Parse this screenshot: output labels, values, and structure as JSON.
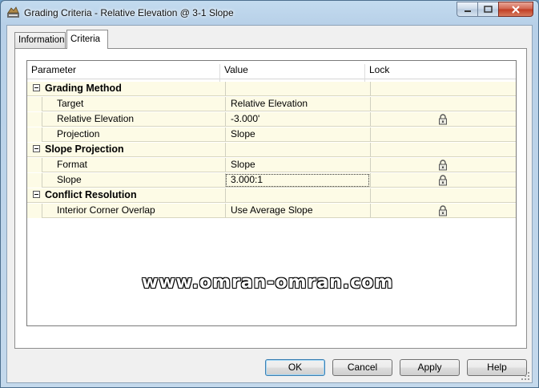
{
  "window": {
    "title": "Grading Criteria - Relative Elevation @ 3-1 Slope"
  },
  "tabs": [
    {
      "label": "Information",
      "active": false
    },
    {
      "label": "Criteria",
      "active": true
    }
  ],
  "grid": {
    "columns": [
      "Parameter",
      "Value",
      "Lock"
    ],
    "groups": [
      {
        "name": "Grading Method",
        "expanded": true,
        "rows": [
          {
            "parameter": "Target",
            "value": "Relative Elevation",
            "locked": false
          },
          {
            "parameter": "Relative Elevation",
            "value": "-3.000'",
            "locked": true
          },
          {
            "parameter": "Projection",
            "value": "Slope",
            "locked": false
          }
        ]
      },
      {
        "name": "Slope Projection",
        "expanded": true,
        "rows": [
          {
            "parameter": "Format",
            "value": "Slope",
            "locked": true
          },
          {
            "parameter": "Slope",
            "value": "3.000:1",
            "locked": true,
            "focused": true
          }
        ]
      },
      {
        "name": "Conflict Resolution",
        "expanded": true,
        "rows": [
          {
            "parameter": "Interior Corner Overlap",
            "value": "Use Average Slope",
            "locked": true
          }
        ]
      }
    ]
  },
  "watermark": "www.omran-omran.com",
  "buttons": {
    "ok": "OK",
    "cancel": "Cancel",
    "apply": "Apply",
    "help": "Help"
  },
  "colors": {
    "row_background": "#fdfbe6",
    "title_bar": "#b7d0e8",
    "close_button": "#c03b22"
  }
}
